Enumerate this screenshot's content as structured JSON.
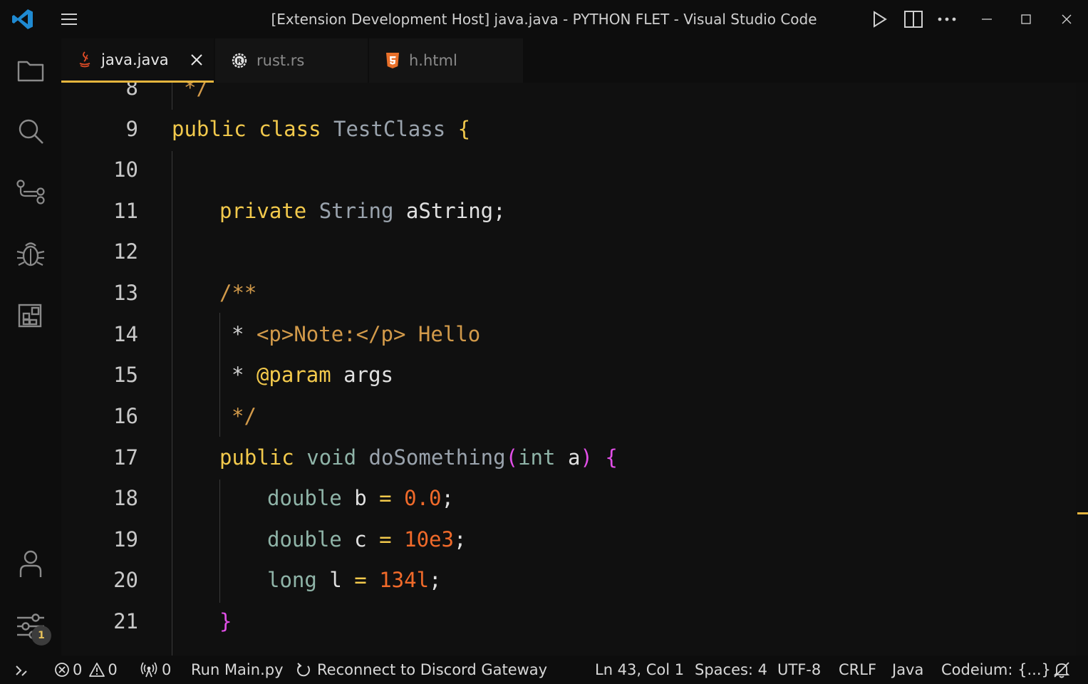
{
  "window": {
    "title": "[Extension Development Host] java.java - PYTHON FLET - Visual Studio Code",
    "accent": "#e5b53e"
  },
  "tabs": [
    {
      "label": "java.java",
      "icon": "java-icon",
      "active": true
    },
    {
      "label": "rust.rs",
      "icon": "rust-icon",
      "active": false
    },
    {
      "label": "h.html",
      "icon": "html5-icon",
      "active": false
    }
  ],
  "activity": {
    "icons": [
      "files-icon",
      "search-icon",
      "source-control-icon",
      "debug-icon",
      "extensions-icon",
      "account-icon",
      "settings-icon"
    ],
    "settings_badge": "1"
  },
  "editor": {
    "line_numbers": [
      "8",
      "9",
      "10",
      "11",
      "12",
      "13",
      "14",
      "15",
      "16",
      "17",
      "18",
      "19",
      "20",
      "21"
    ],
    "tokens": {
      "l8_comment": "*/",
      "public": "public",
      "class": "class",
      "class_name": "TestClass",
      "brace_open": "{",
      "private": "private",
      "string_type": "String",
      "field": "aString;",
      "doc_open": "/**",
      "star": "*",
      "doc_note": "<p>Note:</p> Hello",
      "param_tag": "@param",
      "param_name": "args",
      "doc_close": "*/",
      "void": "void",
      "method_name": "doSomething",
      "paren_open": "(",
      "int": "int",
      "param_a": "a",
      "paren_close": ")",
      "double": "double",
      "var_b": "b",
      "equals": "=",
      "val_b": "0.0",
      "semicolon": ";",
      "var_c": "c",
      "val_c": "10e3",
      "long": "long",
      "var_l": "l",
      "val_l": "134l",
      "brace_close": "}"
    }
  },
  "statusbar": {
    "errors": "0",
    "warnings": "0",
    "ports": "0",
    "run": "Run Main.py",
    "reconnect": "Reconnect to Discord Gateway",
    "position": "Ln 43, Col 1",
    "spaces": "Spaces: 4",
    "encoding": "UTF-8",
    "eol": "CRLF",
    "language": "Java",
    "codeium": "Codeium: {...}"
  }
}
